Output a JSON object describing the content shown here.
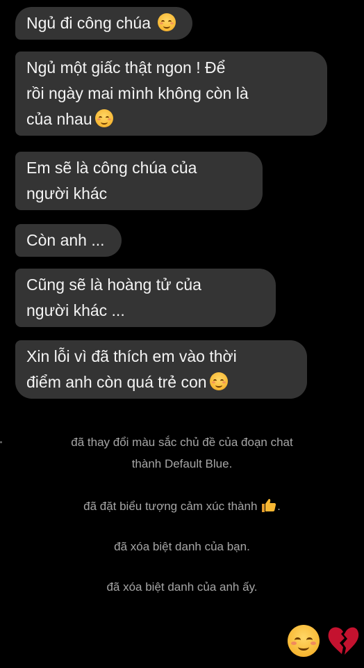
{
  "conversation": {
    "messages": [
      {
        "text": "Ngủ đi công chúa",
        "emoji": "smiling-blush-emoji"
      },
      {
        "line1": "Ngủ một giấc thật ngon ! Để",
        "line2": "rồi ngày mai mình không còn là",
        "line3": "của nhau",
        "emoji": "smiling-blush-emoji"
      },
      {
        "line1": "Em sẽ là công chúa của",
        "line2": "người khác"
      },
      {
        "text": "Còn anh ..."
      },
      {
        "line1": "Cũng sẽ là hoàng tử của",
        "line2": "người khác ..."
      },
      {
        "line1": "Xin lỗi vì đã thích em vào thời",
        "line2": "điểm anh còn quá trẻ con",
        "emoji": "smiling-blush-emoji"
      }
    ],
    "system_notes": {
      "theme_line1": "đã thay đổi màu sắc chủ đề của đoạn chat",
      "theme_line2": "thành Default Blue.",
      "emoji_change": "đã đặt biểu tượng cảm xúc thành",
      "emoji_change_end": ".",
      "emoji_change_icon": "thumbs-up-icon",
      "nickname_you": "đã xóa biệt danh của bạn.",
      "nickname_him": "đã xóa biệt danh của anh ấy."
    },
    "reactions": [
      "smiling-blush-emoji",
      "broken-heart-emoji"
    ]
  },
  "colors": {
    "background": "#000000",
    "bubble": "#343434",
    "bubble_text": "#f4f4f4",
    "system_text": "#a6a6a6",
    "thumb": "#f7b733",
    "heart": "#c4122f"
  }
}
